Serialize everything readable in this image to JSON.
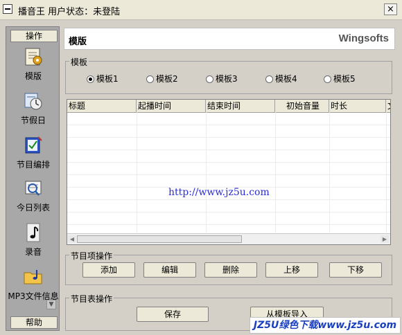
{
  "window": {
    "title": "播音王  用户状态：未登陆",
    "close_glyph": "×"
  },
  "sidebar": {
    "top_button": "操作",
    "bottom_button": "帮助",
    "items": [
      {
        "label": "模版",
        "icon": "template-icon"
      },
      {
        "label": "节假日",
        "icon": "calendar-clock-icon"
      },
      {
        "label": "节目编排",
        "icon": "schedule-icon"
      },
      {
        "label": "今日列表",
        "icon": "today-list-icon"
      },
      {
        "label": "录音",
        "icon": "music-note-icon"
      },
      {
        "label": "MP3文件信息",
        "icon": "folder-music-icon"
      }
    ]
  },
  "header": {
    "title": "模版",
    "brand": "Wingsofts"
  },
  "template_group": {
    "label": "模板",
    "options": [
      "模板1",
      "模板2",
      "模板3",
      "模板4",
      "模板5"
    ],
    "selected": 0
  },
  "table": {
    "columns": [
      "标题",
      "起播时间",
      "结束时间",
      "初始音量",
      "时长",
      "文"
    ],
    "watermark": "http://www.jz5u.com"
  },
  "item_ops": {
    "label": "节目项操作",
    "buttons": [
      "添加",
      "编辑",
      "删除",
      "上移",
      "下移"
    ]
  },
  "table_ops": {
    "label": "节目表操作",
    "buttons": [
      "保存",
      "从模板导入"
    ]
  },
  "footer": {
    "watermark": "JZ5U绿色下载www.jz5u.com"
  },
  "colors": {
    "accent": "#2b2bd6",
    "face": "#d4d0c8"
  }
}
